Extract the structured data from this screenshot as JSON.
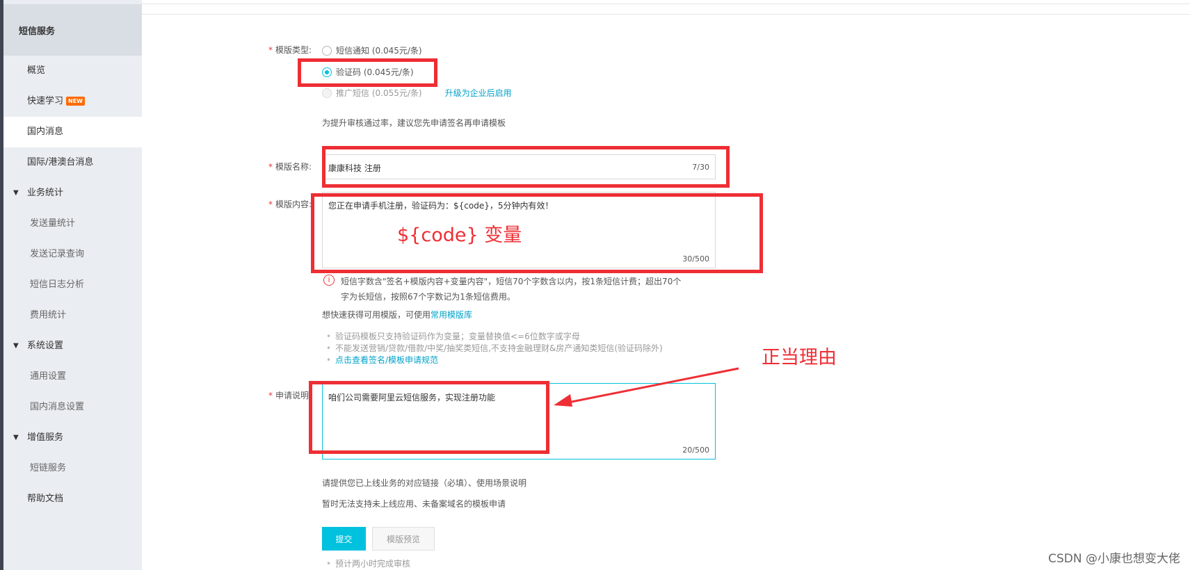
{
  "sidebar": {
    "title": "短信服务",
    "items": [
      {
        "label": "概览"
      },
      {
        "label": "快速学习",
        "badge": "NEW"
      },
      {
        "label": "国内消息"
      },
      {
        "label": "国际/港澳台消息"
      },
      {
        "label": "业务统计"
      },
      {
        "label": "发送量统计"
      },
      {
        "label": "发送记录查询"
      },
      {
        "label": "短信日志分析"
      },
      {
        "label": "费用统计"
      },
      {
        "label": "系统设置"
      },
      {
        "label": "通用设置"
      },
      {
        "label": "国内消息设置"
      },
      {
        "label": "增值服务"
      },
      {
        "label": "短链服务"
      },
      {
        "label": "帮助文档"
      }
    ]
  },
  "form": {
    "template_type": {
      "label": "模版类型:",
      "options": [
        {
          "label": "短信通知 (0.045元/条)",
          "checked": false
        },
        {
          "label": "验证码 (0.045元/条)",
          "checked": true
        },
        {
          "label": "推广短信 (0.055元/条)",
          "checked": false,
          "disabled": true
        }
      ],
      "upgrade_link": "升级为企业后启用",
      "hint": "为提升审核通过率，建议您先申请签名再申请模板"
    },
    "template_name": {
      "label": "模版名称:",
      "value": "康康科技 注册",
      "count": "7/30"
    },
    "template_content": {
      "label": "模版内容:",
      "value": "您正在申请手机注册，验证码为：${code}，5分钟内有效！",
      "count": "30/500",
      "warning_line1": "短信字数含\"签名+模版内容+变量内容\"，短信70个字数含以内，按1条短信计费；超出70个",
      "warning_line2": "字为长短信，按照67个字数记为1条短信费用。",
      "library_prefix": "想快速获得可用模版，可使用",
      "library_link": "常用模版库",
      "rules": [
        "验证码模板只支持验证码作为变量；变量替换值<=6位数字或字母",
        "不能发送营销/贷款/借款/中奖/抽奖类短信,不支持金融理财&房产通知类短信(验证码除外)"
      ],
      "rules_link": "点击查看签名/模板申请规范"
    },
    "application_desc": {
      "label": "申请说明:",
      "value": "咱们公司需要阿里云短信服务，实现注册功能",
      "count": "20/500",
      "hint1": "请提供您已上线业务的对应链接（必填）、使用场景说明",
      "hint2": "暂时无法支持未上线应用、未备案域名的模板申请"
    },
    "submit_label": "提交",
    "preview_label": "模版预览",
    "footer_note": "预计两小时完成审核"
  },
  "annotations": {
    "variable_note": "${code}  变量",
    "reason_note": "正当理由",
    "color": "#ee2e34"
  },
  "watermark": "CSDN @小康也想变大佬",
  "colors": {
    "accent": "#00c1de",
    "brand": "#ff6a00",
    "required": "#e4393c"
  }
}
